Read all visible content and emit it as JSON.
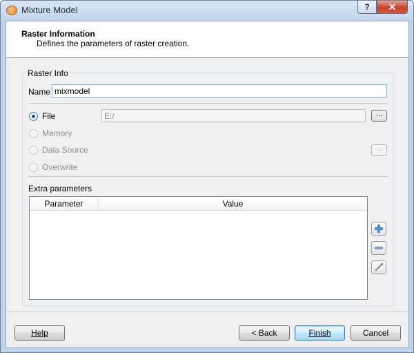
{
  "window": {
    "title": "Mixture Model",
    "help_glyph": "?",
    "close_glyph": "✕"
  },
  "header": {
    "title": "Raster Information",
    "subtitle": "Defines the parameters of raster creation."
  },
  "raster_info": {
    "group_title": "Raster Info",
    "name_label": "Name",
    "name_value": "mixmodel"
  },
  "output": {
    "options": [
      {
        "label": "File",
        "checked": true,
        "enabled": true
      },
      {
        "label": "Memory",
        "checked": false,
        "enabled": false
      },
      {
        "label": "Data Source",
        "checked": false,
        "enabled": false
      },
      {
        "label": "Overwrite",
        "checked": false,
        "enabled": false
      }
    ],
    "path_value": "E:/",
    "browse_label": "...",
    "datasource_browse_label": "..."
  },
  "extra": {
    "label": "Extra parameters",
    "columns": [
      "Parameter",
      "Value"
    ],
    "rows": []
  },
  "side_buttons": {
    "add_icon": "plus-icon",
    "remove_icon": "minus-icon",
    "edit_icon": "wand-icon"
  },
  "footer": {
    "help_label": "Help",
    "back_label": "< Back",
    "finish_label": "Finish",
    "cancel_label": "Cancel"
  },
  "colors": {
    "accent": "#3c7fb1",
    "close": "#c7422a",
    "add": "#4a90d9"
  }
}
